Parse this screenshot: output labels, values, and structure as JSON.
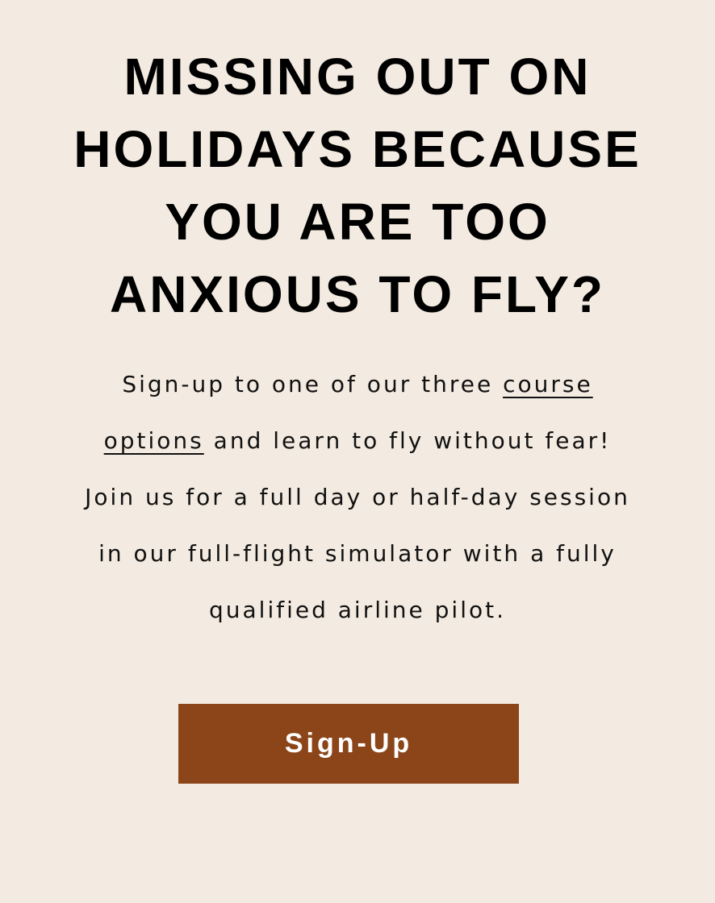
{
  "hero": {
    "headline_lines": [
      "MISSING OUT ON",
      "HOLIDAYS BECAUSE",
      "YOU ARE TOO",
      "ANXIOUS TO FLY?"
    ],
    "body": {
      "line1_prefix": "Sign-up to one of our three ",
      "link_part1": "course",
      "link_part2": "options",
      "line2_suffix": " and learn to fly without fear!",
      "line3": "Join us for a full day or half-day session",
      "line4": "in our full-flight simulator with a fully",
      "line5": "qualified airline pilot."
    },
    "cta_label": "Sign-Up"
  },
  "colors": {
    "background": "#f3ebe1",
    "accent_button": "#8b4519",
    "text": "#000000",
    "button_text": "#ffffff"
  }
}
